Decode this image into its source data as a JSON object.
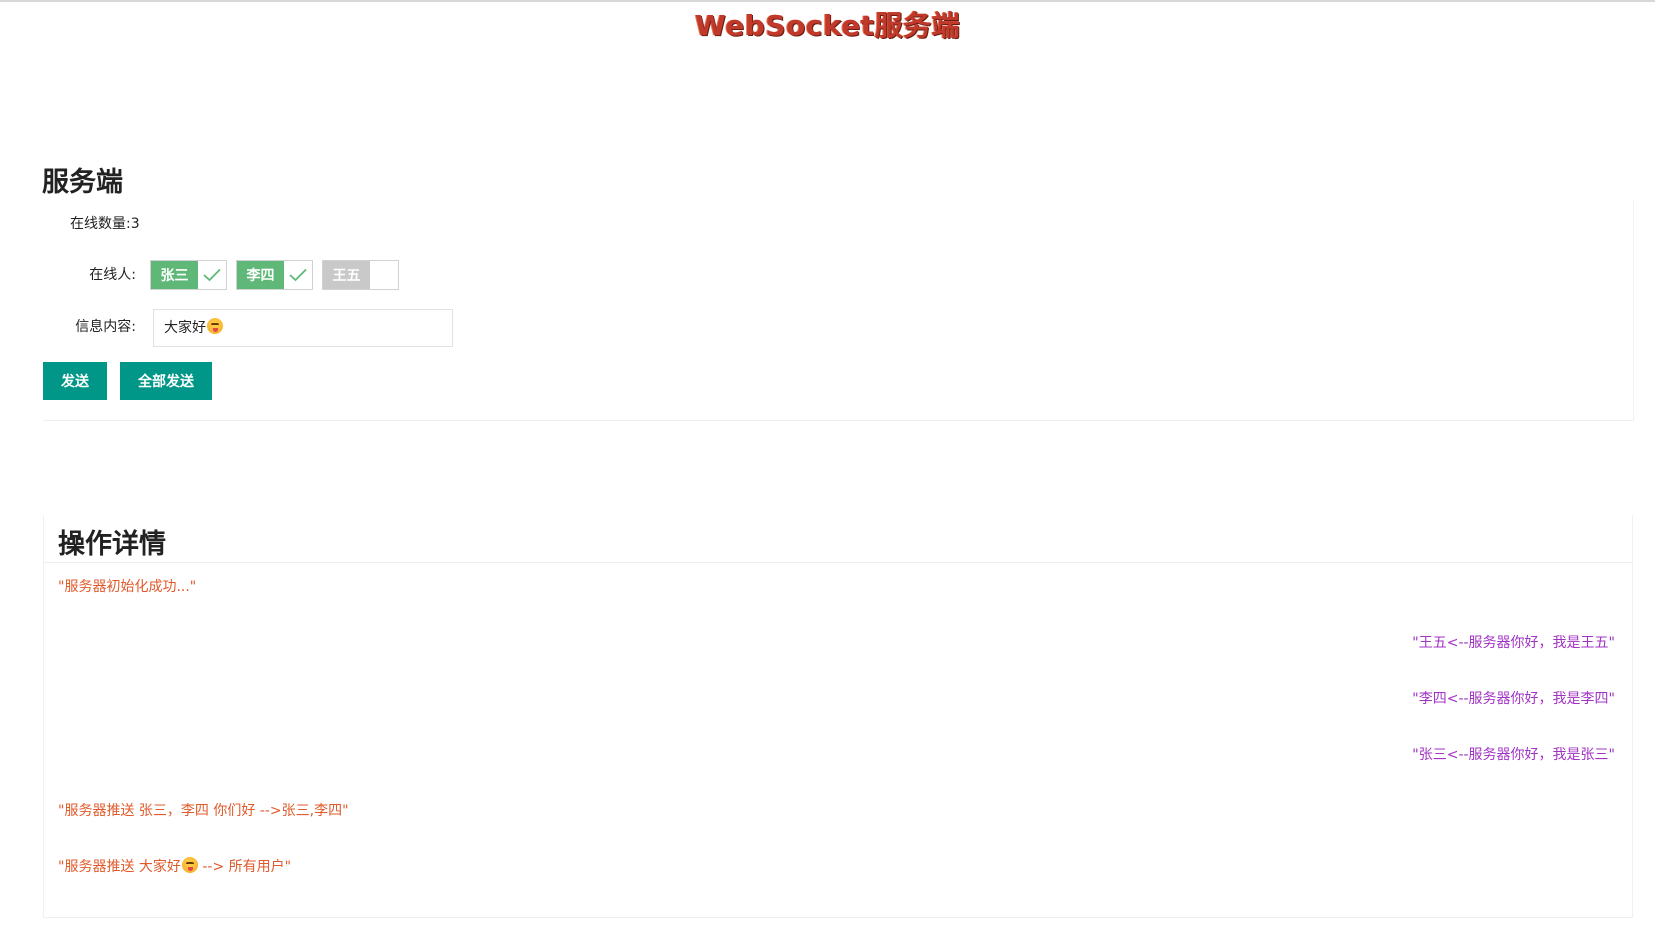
{
  "app": {
    "title": "WebSocket服务端"
  },
  "server": {
    "section_title": "服务端",
    "online_count_text": "在线数量:3",
    "online_users_label": "在线人:",
    "users": [
      {
        "name": "张三",
        "checked": true
      },
      {
        "name": "李四",
        "checked": true
      },
      {
        "name": "王五",
        "checked": false
      }
    ],
    "message_label": "信息内容:",
    "message_value": "大家好",
    "send_button": "发送",
    "send_all_button": "全部发送"
  },
  "details": {
    "section_title": "操作详情",
    "logs": [
      {
        "text": "\"服务器初始化成功...\"",
        "side": "left"
      },
      {
        "text": "\"王五<--服务器你好，我是王五\"",
        "side": "right"
      },
      {
        "text": "\"李四<--服务器你好，我是李四\"",
        "side": "right"
      },
      {
        "text": "\"张三<--服务器你好，我是张三\"",
        "side": "right"
      },
      {
        "text": "\"服务器推送 张三，李四 你们好 -->张三,李四\"",
        "side": "left"
      },
      {
        "text_before": "\"服务器推送 大家好",
        "text_after": " --> 所有用户\"",
        "side": "left"
      }
    ]
  },
  "colors": {
    "title": "#c0392b",
    "button": "#009688",
    "chip_on": "#5fb878",
    "chip_off": "#c9c9c9",
    "log_server": "#e05a2b",
    "log_client": "#a233c6"
  }
}
